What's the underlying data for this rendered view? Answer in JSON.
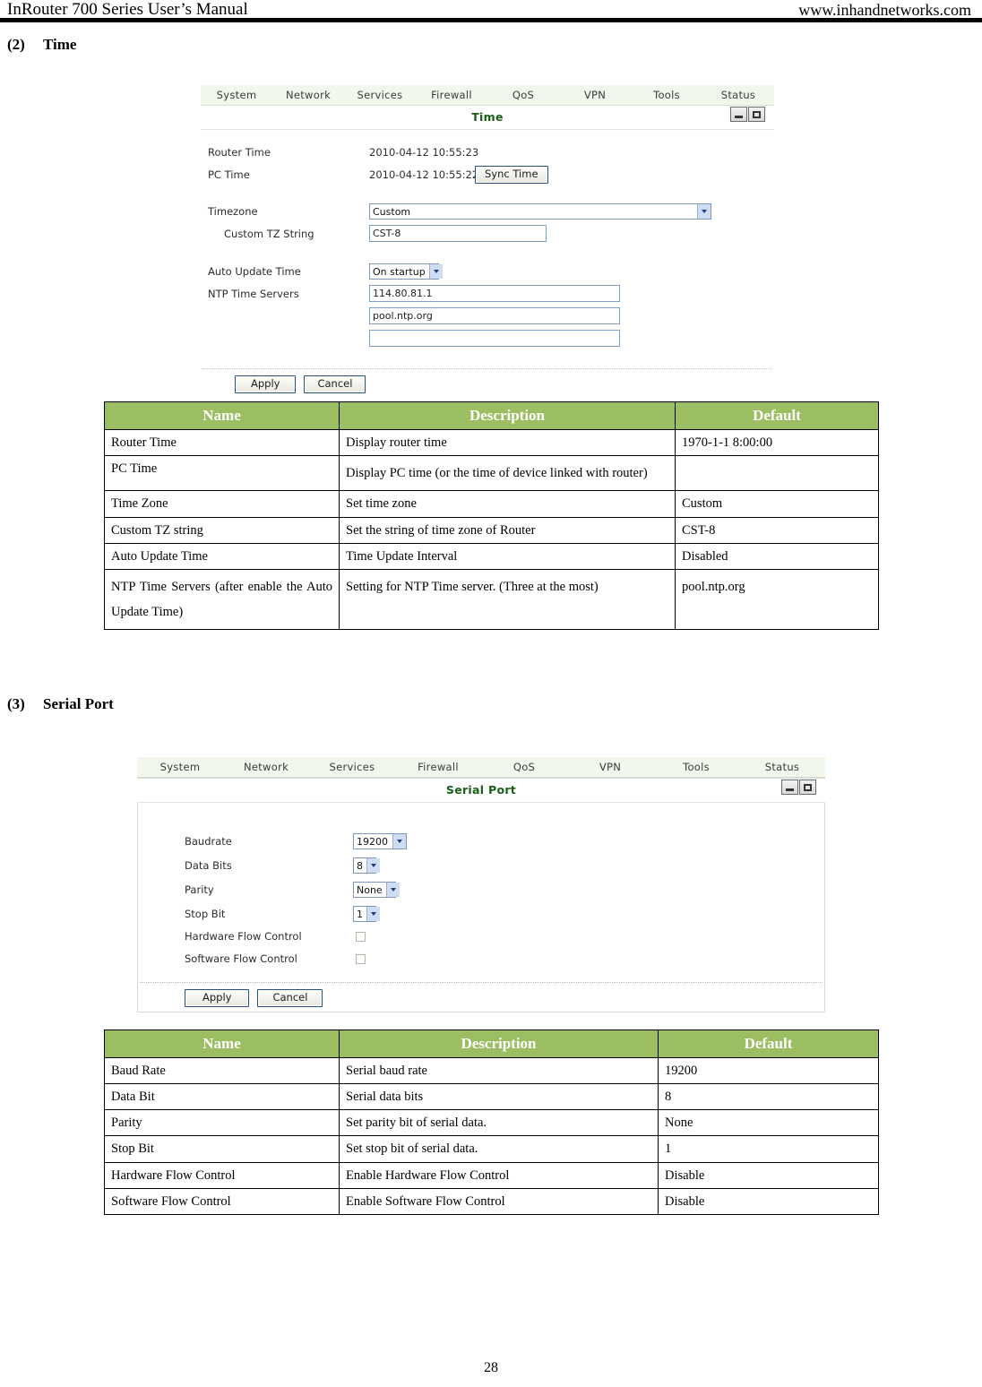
{
  "header": {
    "left": "InRouter 700 Series User’s Manual",
    "right": "www.inhandnetworks.com"
  },
  "sections": [
    {
      "number": "(2)",
      "title": "Time"
    },
    {
      "number": "(3)",
      "title": "Serial Port"
    }
  ],
  "colors": {
    "table_header_green": "#9CBE62",
    "panel_title_green": "#186018",
    "navbar_bg": "#F2F7EC",
    "textbox_border": "#7DA0C4"
  },
  "time_panel": {
    "nav": [
      "System",
      "Network",
      "Services",
      "Firewall",
      "QoS",
      "VPN",
      "Tools",
      "Status"
    ],
    "title": "Time",
    "window_buttons": [
      "minimize-button",
      "maximize-button"
    ],
    "rows": {
      "router_time_label": "Router Time",
      "router_time_value": "2010-04-12 10:55:23",
      "pc_time_label": "PC Time",
      "pc_time_value": "2010-04-12 10:55:22",
      "sync_button": "Sync Time",
      "timezone_label": "Timezone",
      "timezone_value": "Custom",
      "custom_tz_label": "Custom TZ String",
      "custom_tz_value": "CST-8",
      "auto_update_label": "Auto Update Time",
      "auto_update_value": "On startup",
      "ntp_label": "NTP Time Servers",
      "ntp_server_1": "114.80.81.1",
      "ntp_server_2": "pool.ntp.org",
      "ntp_server_3": ""
    },
    "apply_button": "Apply",
    "cancel_button": "Cancel"
  },
  "time_table": {
    "headers": [
      "Name",
      "Description",
      "Default"
    ],
    "rows": [
      {
        "name": "Router Time",
        "description": "Display router time",
        "default": "1970-1-1 8:00:00"
      },
      {
        "name": "PC Time",
        "description": "Display  PC  time    (or  the  time  of  device  linked  with  router)",
        "default": ""
      },
      {
        "name": "Time Zone",
        "description": "Set time zone",
        "default": "Custom"
      },
      {
        "name": "Custom TZ string",
        "description": "Set the string of time zone of Router",
        "default": "CST-8"
      },
      {
        "name": "Auto Update Time",
        "description": "Time Update Interval",
        "default": "Disabled"
      },
      {
        "name": "NTP  Time  Servers  (after  enable  the  Auto Update Time)",
        "description": "Setting for NTP Time server.    (Three at the most)",
        "default": "pool.ntp.org"
      }
    ]
  },
  "serial_panel": {
    "nav": [
      "System",
      "Network",
      "Services",
      "Firewall",
      "QoS",
      "VPN",
      "Tools",
      "Status"
    ],
    "title": "Serial Port",
    "window_buttons": [
      "minimize-button",
      "maximize-button"
    ],
    "rows": {
      "baudrate_label": "Baudrate",
      "baudrate_value": "19200",
      "data_bits_label": "Data Bits",
      "data_bits_value": "8",
      "parity_label": "Parity",
      "parity_value": "None",
      "stop_bit_label": "Stop Bit",
      "stop_bit_value": "1",
      "hw_flow_label": "Hardware Flow Control",
      "hw_flow_checked": false,
      "sw_flow_label": "Software Flow Control",
      "sw_flow_checked": false
    },
    "apply_button": "Apply",
    "cancel_button": "Cancel"
  },
  "serial_table": {
    "headers": [
      "Name",
      "Description",
      "Default"
    ],
    "rows": [
      {
        "name": "Baud Rate",
        "description": "Serial baud rate",
        "default": "19200"
      },
      {
        "name": "Data Bit",
        "description": "Serial data bits",
        "default": "8"
      },
      {
        "name": "Parity",
        "description": "Set parity bit of serial data.",
        "default": "None"
      },
      {
        "name": "Stop Bit",
        "description": "Set stop bit of serial data.",
        "default": "1"
      },
      {
        "name": "Hardware Flow Control",
        "description": "Enable Hardware Flow Control",
        "default": "Disable"
      },
      {
        "name": "Software Flow Control",
        "description": "Enable Software Flow Control",
        "default": "Disable"
      }
    ]
  },
  "footer": {
    "page_number": "28"
  }
}
